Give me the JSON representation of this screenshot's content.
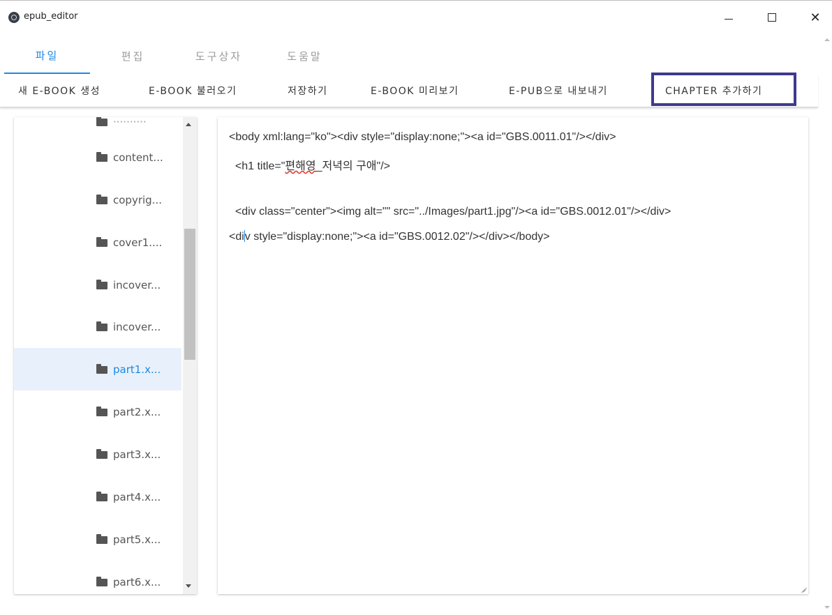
{
  "window": {
    "title": "epub_editor",
    "close_glyph": "✕"
  },
  "menu_tabs": [
    "파일",
    "편집",
    "도구상자",
    "도움말"
  ],
  "toolbar": {
    "items": [
      {
        "label": "새 E-BOOK 생성"
      },
      {
        "label": "E-BOOK 불러오기"
      },
      {
        "label": "저장하기"
      },
      {
        "label": "E-BOOK 미리보기"
      },
      {
        "label": "E-PUB으로 내보내기"
      },
      {
        "label": "CHAPTER 추가하기"
      }
    ],
    "highlighted_item": "CHAPTER 추가하기",
    "highlight_color": "#3e3a8e"
  },
  "sidebar": {
    "files": [
      {
        "name": "content...",
        "icon": "folder-icon"
      },
      {
        "name": "copyrig...",
        "icon": "folder-icon"
      },
      {
        "name": "cover1....",
        "icon": "folder-icon"
      },
      {
        "name": "incover...",
        "icon": "folder-icon"
      },
      {
        "name": "incover...",
        "icon": "folder-icon"
      },
      {
        "name": "part1.x...",
        "icon": "folder-icon",
        "selected": true
      },
      {
        "name": "part2.x...",
        "icon": "folder-icon"
      },
      {
        "name": "part3.x...",
        "icon": "folder-icon"
      },
      {
        "name": "part4.x...",
        "icon": "folder-icon"
      },
      {
        "name": "part5.x...",
        "icon": "folder-icon"
      },
      {
        "name": "part6.x...",
        "icon": "folder-icon"
      }
    ]
  },
  "editor": {
    "line1": "<body xml:lang=\"ko\"><div style=\"display:none;\"><a id=\"GBS.0011.01\"/></div>",
    "line2_prefix": "  <h1 title=\"",
    "line2_squiggle": "편해영",
    "line2_suffix": "_저녁의 구애\"/>",
    "line3": "  <div class=\"center\"><img alt=\"\" src=\"../Images/part1.jpg\"/><a id=\"GBS.0012.01\"/></div>",
    "line4_before_caret": "<di",
    "line4_after_caret": "v style=\"display:none;\"><a id=\"GBS.0012.02\"/></div></body>"
  },
  "colors": {
    "accent": "#1e88e5",
    "selected_bg": "#e8f1fb"
  }
}
